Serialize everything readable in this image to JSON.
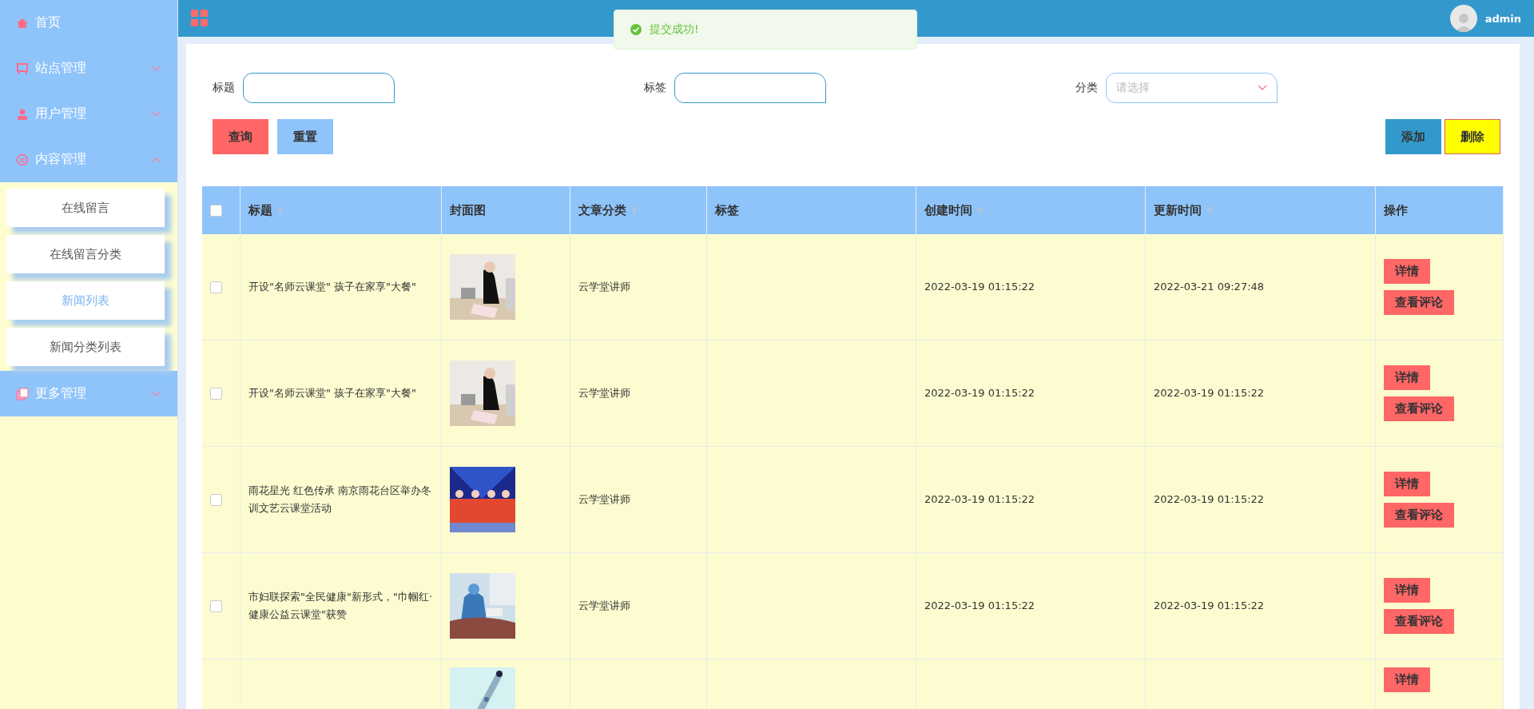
{
  "sidebar": {
    "items": [
      {
        "label": "首页",
        "kind": "link"
      },
      {
        "label": "站点管理",
        "kind": "group",
        "expanded": false
      },
      {
        "label": "用户管理",
        "kind": "group",
        "expanded": false
      },
      {
        "label": "内容管理",
        "kind": "group",
        "expanded": true,
        "children": [
          {
            "label": "在线留言",
            "selected": false
          },
          {
            "label": "在线留言分类",
            "selected": false
          },
          {
            "label": "新闻列表",
            "selected": true
          },
          {
            "label": "新闻分类列表",
            "selected": false
          }
        ]
      },
      {
        "label": "更多管理",
        "kind": "group",
        "expanded": false
      }
    ]
  },
  "header": {
    "user": "admin"
  },
  "toast": {
    "message": "提交成功!"
  },
  "search": {
    "fields": [
      {
        "label": "标题",
        "kind": "input"
      },
      {
        "label": "标签",
        "kind": "input"
      },
      {
        "label": "分类",
        "kind": "select",
        "placeholder": "请选择"
      }
    ],
    "buttons": [
      {
        "label": "查询",
        "kind": "danger"
      },
      {
        "label": "重置",
        "kind": "light"
      }
    ],
    "actions": [
      {
        "label": "添加",
        "kind": "primary"
      },
      {
        "label": "删除",
        "kind": "warning"
      }
    ]
  },
  "table": {
    "select_all": {
      "checked": false
    },
    "columns": [
      {
        "label": "标题",
        "sortable": true
      },
      {
        "label": "封面图",
        "sortable": false
      },
      {
        "label": "文章分类",
        "sortable": true
      },
      {
        "label": "标签",
        "sortable": false
      },
      {
        "label": "创建时间",
        "sortable": true
      },
      {
        "label": "更新时间",
        "sortable": true
      },
      {
        "label": "操作",
        "sortable": false
      }
    ],
    "rows": [
      {
        "checked": false,
        "title": "开设\"名师云课堂\" 孩子在家享\"大餐\"",
        "category": "云学堂讲师",
        "created": "2022-03-19 01:15:22",
        "updated": "2022-03-21 09:27:48",
        "actions": [
          "详情",
          "查看评论"
        ]
      },
      {
        "checked": false,
        "title": "开设\"名师云课堂\" 孩子在家享\"大餐\"",
        "category": "云学堂讲师",
        "created": "2022-03-19 01:15:22",
        "updated": "2022-03-19 01:15:22",
        "actions": [
          "详情",
          "查看评论"
        ]
      },
      {
        "checked": false,
        "title": "雨花星光 红色传承 南京雨花台区举办冬训文艺云课堂活动",
        "category": "云学堂讲师",
        "created": "2022-03-19 01:15:22",
        "updated": "2022-03-19 01:15:22",
        "actions": [
          "详情",
          "查看评论"
        ]
      },
      {
        "checked": false,
        "title": "市妇联探索\"全民健康\"新形式，\"巾帼红·健康公益云课堂\"获赞",
        "category": "云学堂讲师",
        "created": "2022-03-19 01:15:22",
        "updated": "2022-03-19 01:15:22",
        "actions": [
          "详情",
          "查看评论"
        ]
      },
      {
        "kind": "partial",
        "actions": [
          "详情"
        ]
      }
    ]
  }
}
